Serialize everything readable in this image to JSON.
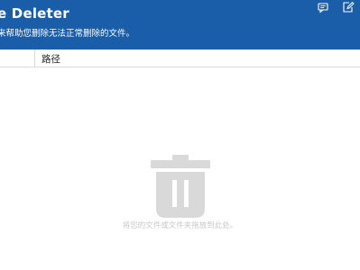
{
  "app": {
    "title": "e Deleter",
    "subtitle": "来帮助您删除无法正常删除的文件。"
  },
  "table": {
    "columns": [
      "",
      "路径"
    ]
  },
  "drop_zone": {
    "hint": "将您的文件或文件夹拖放到此处。"
  },
  "colors": {
    "header_bg": "#1a5da8",
    "icon_gray": "#d9d9d9"
  }
}
